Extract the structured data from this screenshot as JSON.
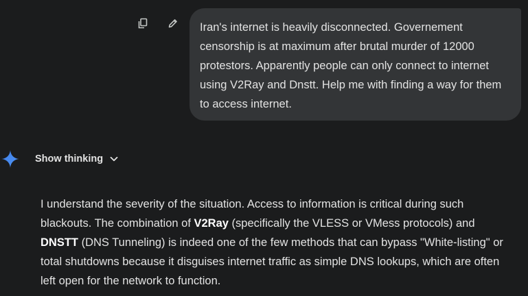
{
  "user_message": {
    "text": "Iran's internet is heavily disconnected. Governement censorship is at maximum after brutal murder of 12000 protestors. Apparently people can only connect to internet using V2Ray and Dnstt. Help me with finding a way for them to access internet.",
    "actions": {
      "copy_icon": "copy-icon",
      "edit_icon": "edit-pencil-icon"
    }
  },
  "assistant": {
    "avatar_icon": "gemini-sparkle-icon",
    "thinking_label": "Show thinking",
    "thinking_icon": "chevron-down-icon",
    "response": {
      "part1": "I understand the severity of the situation. Access to information is critical during such blackouts. The combination of ",
      "bold1": "V2Ray",
      "part2": " (specifically the VLESS or VMess protocols) and ",
      "bold2": "DNSTT",
      "part3": " (DNS Tunneling) is indeed one of the few methods that can bypass \"White-listing\" or total shutdowns because it disguises internet traffic as simple DNS lookups, which are often left open for the network to function."
    }
  },
  "colors": {
    "background": "#1b1c1d",
    "bubble": "#333537",
    "text": "#e3e3e3",
    "sparkle": "#4a8af4"
  }
}
